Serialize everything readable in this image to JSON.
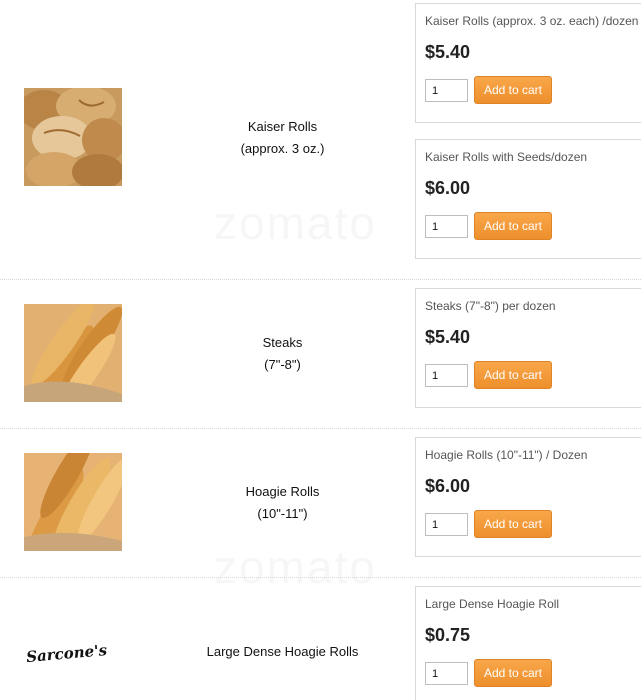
{
  "products": [
    {
      "name_line1": "Kaiser Rolls",
      "name_line2": "(approx. 3 oz.)",
      "image": "kaiser-rolls-photo",
      "options": [
        {
          "title": "Kaiser Rolls (approx. 3 oz. each) /dozen",
          "price": "$5.40",
          "qty": "1",
          "button": "Add to cart"
        },
        {
          "title": "Kaiser Rolls with Seeds/dozen",
          "price": "$6.00",
          "qty": "1",
          "button": "Add to cart"
        }
      ]
    },
    {
      "name_line1": "Steaks",
      "name_line2": "(7\"-8\")",
      "image": "steak-rolls-photo",
      "options": [
        {
          "title": "Steaks (7\"-8\") per dozen",
          "price": "$5.40",
          "qty": "1",
          "button": "Add to cart"
        }
      ]
    },
    {
      "name_line1": "Hoagie Rolls",
      "name_line2": "(10\"-11\")",
      "image": "hoagie-rolls-photo",
      "options": [
        {
          "title": "Hoagie Rolls (10\"-11\") / Dozen",
          "price": "$6.00",
          "qty": "1",
          "button": "Add to cart"
        }
      ]
    },
    {
      "name_line1": "Large Dense Hoagie Rolls",
      "name_line2": "",
      "image": "sarcones-logo",
      "logo_text": "Sarcone's",
      "options": [
        {
          "title": "Large Dense Hoagie Roll",
          "price": "$0.75",
          "qty": "1",
          "button": "Add to cart"
        }
      ]
    }
  ],
  "watermark": "zomato",
  "colors": {
    "button": "#f29a3a",
    "price": "#222222",
    "border": "#d9d9d9"
  }
}
